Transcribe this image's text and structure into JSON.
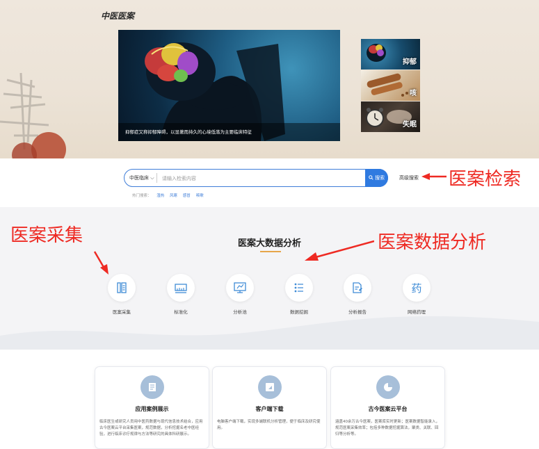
{
  "banner": {
    "site_title": "中医医案",
    "hero_caption": "抑郁症又称抑郁障碍，以显著而持久的心境低落为主要临床特征",
    "thumbnails": [
      {
        "label": "抑郁"
      },
      {
        "label": "咳"
      },
      {
        "label": "失眠"
      }
    ]
  },
  "search": {
    "category": "中医临床",
    "placeholder": "请输入检索内容",
    "button_label": "搜索",
    "advanced_label": "高级搜索",
    "hot_label": "热门搜索：",
    "hot_words": [
      "湿热",
      "风寒",
      "感冒",
      "咳嗽"
    ]
  },
  "annotations": {
    "search": "医案检索",
    "collection": "医案采集",
    "analysis": "医案数据分析"
  },
  "analysis": {
    "title": "医案大数据分析",
    "items": [
      {
        "label": "医案采集",
        "icon": "document-icon"
      },
      {
        "label": "标准化",
        "icon": "ruler-icon"
      },
      {
        "label": "分析池",
        "icon": "monitor-icon"
      },
      {
        "label": "数据挖掘",
        "icon": "list-icon"
      },
      {
        "label": "分析报告",
        "icon": "report-icon"
      },
      {
        "label": "网络药理",
        "icon": "yao-icon",
        "glyph": "药"
      }
    ]
  },
  "cards": [
    {
      "title": "应用案例展示",
      "desc": "临床医生或研究人员用中医药数据与现代信息技术结合，应用古今医案云平台采集医案，规范数据，分析挖掘名老中医经验，进行临床诊疗规律与方法等研究的具体科研展示。"
    },
    {
      "title": "客户端下载",
      "desc": "电脑客户端下载，实现多端联机分析管理，便于临床及研究使用。"
    },
    {
      "title": "古今医案云平台",
      "desc": "涵盖40余万古今医案，医案库实时更新；医案数据智能录入，规范医案采集效率；包括多种数据挖掘算法，聚类、关联、回归等分析等。"
    }
  ],
  "colors": {
    "accent": "#2f7ae0",
    "annotation": "#ee2a23",
    "title_underline": "#e7a64a",
    "card_icon_bg": "#a7bfd9",
    "analysis_icon": "#3e8bd6"
  }
}
